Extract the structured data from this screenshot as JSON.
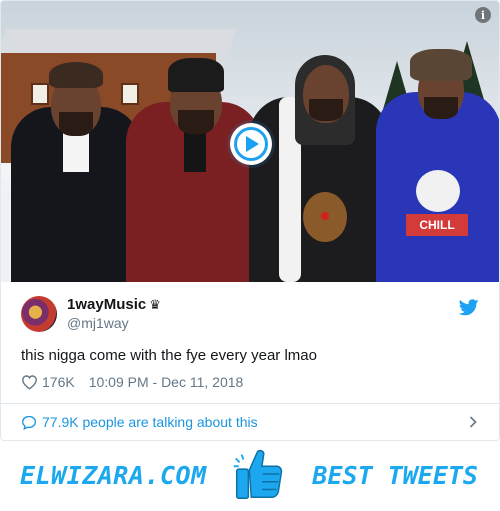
{
  "tweet": {
    "media": {
      "play_label": "Play video",
      "info_glyph": "i"
    },
    "author": {
      "display_name": "1wayMusic",
      "badge": "♛",
      "handle": "@mj1way"
    },
    "text": "this nigga come with the fye every year lmao",
    "likes": "176K",
    "timestamp": "10:09 PM - Dec 11, 2018",
    "talking": "77.9K people are talking about this"
  },
  "banner": {
    "left_text": "ELWIZARA.COM",
    "right_text": "BEST TWEETS"
  },
  "colors": {
    "accent": "#1da1f2",
    "link": "#1b95e0",
    "banner": "#1ba8ee",
    "muted": "#657786"
  }
}
